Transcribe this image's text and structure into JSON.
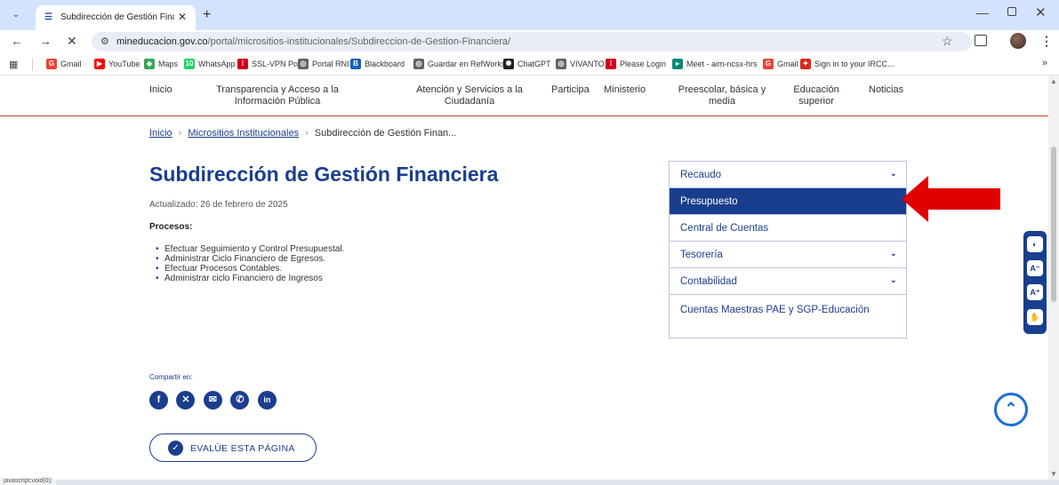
{
  "browser": {
    "tab_title": "Subdirección de Gestión Financ",
    "url_host": "mineducacion.gov.co",
    "url_path": "/portal/micrositios-institucionales/Subdireccion-de-Gestion-Financiera/",
    "bookmarks": [
      {
        "label": "Gmail",
        "icon": "gmail-icon",
        "color": "#ea4335",
        "glyph": "G"
      },
      {
        "label": "YouTube",
        "icon": "youtube-icon",
        "color": "#ff0000",
        "glyph": "▶"
      },
      {
        "label": "Maps",
        "icon": "maps-icon",
        "color": "#34a853",
        "glyph": "◆"
      },
      {
        "label": "WhatsApp",
        "icon": "whatsapp-icon",
        "color": "#25d366",
        "glyph": "10"
      },
      {
        "label": "SSL-VPN Portal",
        "icon": "fortinet-icon",
        "color": "#d0021b",
        "glyph": "⁞"
      },
      {
        "label": "Portal RNI",
        "icon": "globe-icon",
        "color": "#5f6368",
        "glyph": "◎"
      },
      {
        "label": "Blackboard",
        "icon": "blackboard-icon",
        "color": "#1560bd",
        "glyph": "B"
      },
      {
        "label": "Guardar en RefWorks",
        "icon": "globe-icon",
        "color": "#5f6368",
        "glyph": "◎"
      },
      {
        "label": "ChatGPT",
        "icon": "chatgpt-icon",
        "color": "#222",
        "glyph": "✺"
      },
      {
        "label": "VIVANTO",
        "icon": "globe-icon",
        "color": "#5f6368",
        "glyph": "◎"
      },
      {
        "label": "Please Login",
        "icon": "fortinet-icon",
        "color": "#d0021b",
        "glyph": "⁞"
      },
      {
        "label": "Meet - aim-ncsx-hrs",
        "icon": "meet-icon",
        "color": "#00897b",
        "glyph": "▸"
      },
      {
        "label": "Gmail",
        "icon": "gmail-icon",
        "color": "#ea4335",
        "glyph": "G"
      },
      {
        "label": "Sign in to your IRCC...",
        "icon": "maple-leaf-icon",
        "color": "#d52b1e",
        "glyph": "✦"
      }
    ]
  },
  "topnav": [
    {
      "label": "Inicio"
    },
    {
      "label": "Transparencia y Acceso a la Información Pública"
    },
    {
      "label": "Atención y Servicios a la Ciudadanía"
    },
    {
      "label": "Participa"
    },
    {
      "label": "Ministerio"
    },
    {
      "label": "Preescolar, básica y media"
    },
    {
      "label": "Educación superior"
    },
    {
      "label": "Noticias"
    }
  ],
  "breadcrumb": {
    "home": "Inicio",
    "section": "Micrositios Institucionales",
    "current": "Subdirección de Gestión Finan..."
  },
  "main": {
    "title": "Subdirección de Gestión Financiera",
    "updated": "Actualizado: 26 de febrero de 2025",
    "processes_heading": "Procesos:",
    "processes": [
      "Efectuar Seguimiento y Control Presupuestal.",
      "Administrar Ciclo Financiero de Egresos.",
      "Efectuar Procesos Contables.",
      "Administrar ciclo Financiero de Ingresos"
    ],
    "share_label": "Compartir en:",
    "share_icons": [
      "facebook-icon",
      "x-icon",
      "email-icon",
      "whatsapp-icon",
      "linkedin-icon"
    ],
    "rate_button": "EVALÚE ESTA PÁGINA"
  },
  "side_menu": [
    {
      "label": "Recaudo",
      "expandable": true,
      "active": false
    },
    {
      "label": "Presupuesto",
      "expandable": true,
      "active": true
    },
    {
      "label": "Central de Cuentas",
      "expandable": false,
      "active": false
    },
    {
      "label": "Tesorería",
      "expandable": true,
      "active": false
    },
    {
      "label": "Contabilidad",
      "expandable": true,
      "active": false
    },
    {
      "label": "Cuentas Maestras PAE y SGP-Educación",
      "expandable": false,
      "active": false
    }
  ],
  "status_bar": "javascript:void(0);",
  "colors": {
    "brand_blue": "#1a3e8e",
    "accent_red": "#e00000",
    "nav_rule": "#c0392b"
  }
}
